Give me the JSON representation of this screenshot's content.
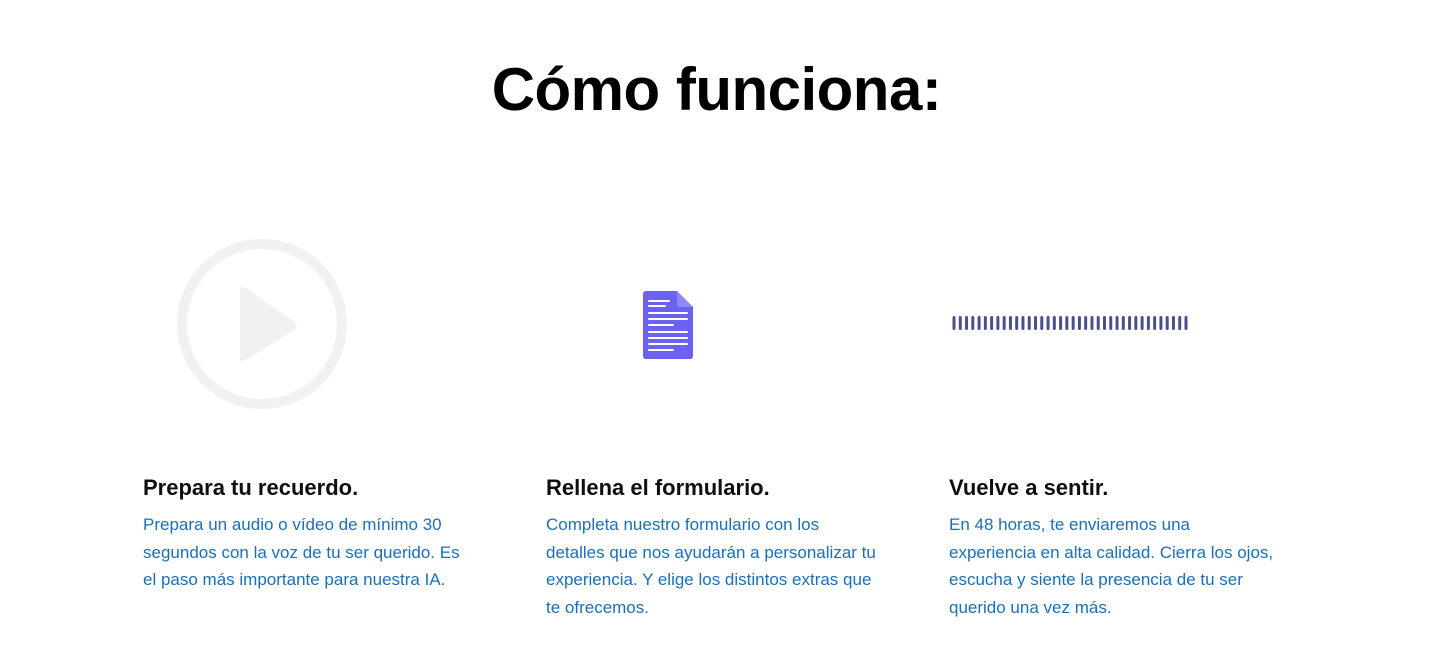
{
  "section": {
    "title": "Cómo funciona:"
  },
  "steps": [
    {
      "icon": "play-circle-icon",
      "title": "Prepara tu recuerdo.",
      "description": "Prepara un audio o vídeo de mínimo 30 segundos con la voz de tu ser querido. Es el paso más importante para nuestra IA."
    },
    {
      "icon": "document-icon",
      "title": "Rellena el formulario.",
      "description": "Completa nuestro formulario con los detalles que nos ayudarán a personalizar tu experiencia. Y elige los distintos extras que te ofrecemos."
    },
    {
      "icon": "audio-waveform-icon",
      "title": "Vuelve a sentir.",
      "description": "En 48 horas, te enviaremos una experiencia en alta calidad. Cierra los ojos, escucha y siente la presencia de tu ser querido una vez más."
    }
  ],
  "colors": {
    "title": "#000000",
    "step_title": "#0f0f12",
    "description": "#1b6fb8",
    "play_icon": "#f1f1f1",
    "document_icon": "#6b63f0",
    "waveform_icon": "#4a4f8e"
  }
}
